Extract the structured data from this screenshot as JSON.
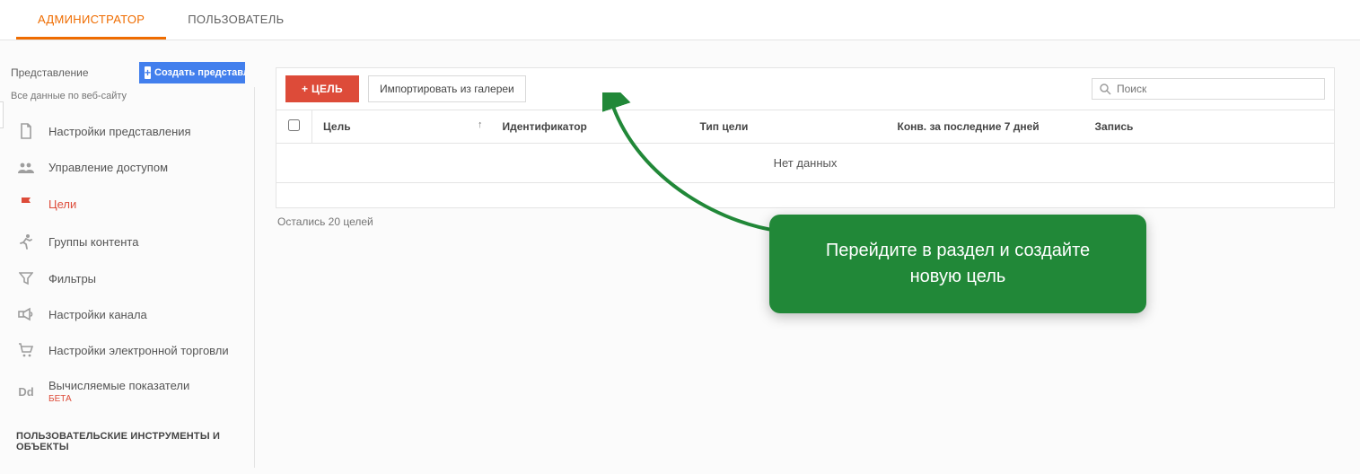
{
  "tabs": {
    "admin": "АДМИНИСТРАТОР",
    "user": "ПОЛЬЗОВАТЕЛЬ"
  },
  "sidebar": {
    "head_label": "Представление",
    "create_label": "Создать представл",
    "view_name": "Все данные по веб-сайту",
    "items": [
      {
        "label": "Настройки представления"
      },
      {
        "label": "Управление доступом"
      },
      {
        "label": "Цели"
      },
      {
        "label": "Группы контента"
      },
      {
        "label": "Фильтры"
      },
      {
        "label": "Настройки канала"
      },
      {
        "label": "Настройки электронной торговли"
      },
      {
        "label": "Вычисляемые показатели",
        "badge": "БЕТА"
      }
    ],
    "section": "ПОЛЬЗОВАТЕЛЬСКИЕ ИНСТРУМЕНТЫ И ОБЪЕКТЫ"
  },
  "toolbar": {
    "new_goal": "+ ЦЕЛЬ",
    "import": "Импортировать из галереи",
    "search_placeholder": "Поиск"
  },
  "table": {
    "cols": {
      "goal": "Цель",
      "id": "Идентификатор",
      "type": "Тип цели",
      "conv": "Конв. за последние 7 дней",
      "record": "Запись"
    },
    "empty": "Нет данных"
  },
  "remaining": "Остались 20 целей",
  "callout": "Перейдите в раздел и создайте новую цель"
}
